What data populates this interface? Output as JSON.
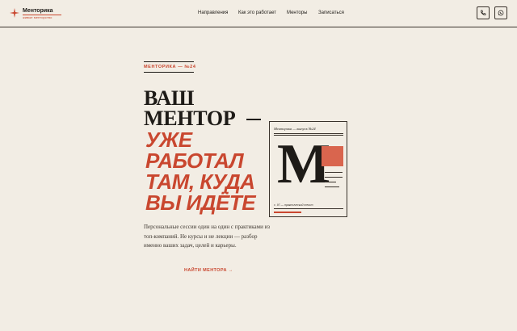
{
  "header": {
    "logo_title": "Менторика",
    "logo_subtitle": "живые менторство",
    "nav": [
      "Направления",
      "Как это работает",
      "Менторы",
      "Записаться"
    ],
    "icons": [
      "phone-icon",
      "whatsapp-icon"
    ]
  },
  "hero": {
    "eyebrow": "МЕНТОРИКА — №24",
    "title_line1": "ВАШ",
    "title_line2": "МЕНТОР",
    "title_red": [
      "УЖЕ",
      "РАБОТАЛ",
      "ТАМ, КУДА",
      "ВЫ ИДЁТЕ"
    ],
    "lead": "Персональные сессии один на один с практиками из топ-компаний. Не курсы и не лекции — разбор именно ваших задач, целей и карьеры.",
    "cta": "НАЙТИ МЕНТОРА →"
  },
  "card": {
    "label": "Менторика — выпуск №24",
    "letter": "М",
    "caption": "с. 97 — практический текст"
  },
  "colors": {
    "background": "#f2ede4",
    "accent": "#c9472f",
    "ink": "#1e1b17"
  }
}
